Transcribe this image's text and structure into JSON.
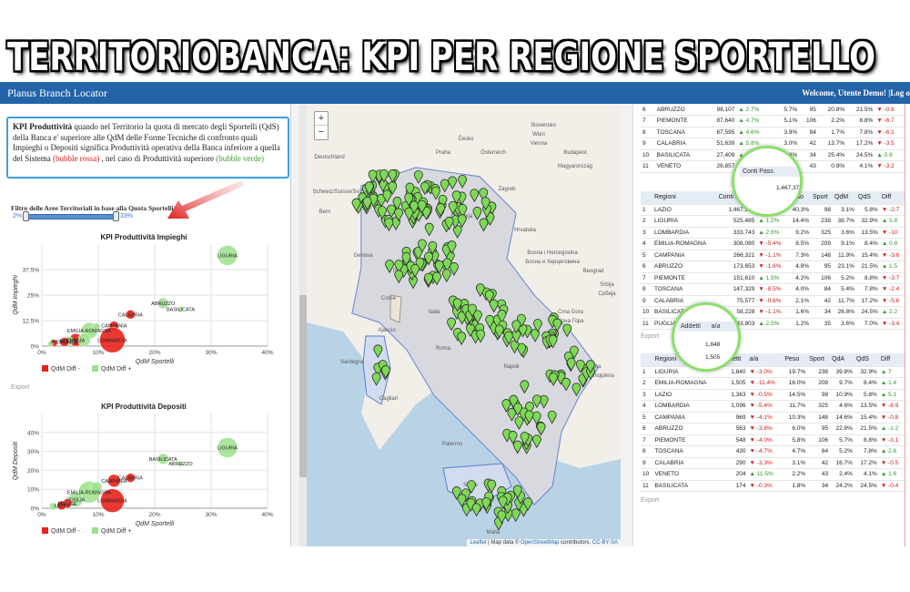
{
  "banner": {
    "title": "TERRITORIOBANCA: KPI PER REGIONE SPORTELLO"
  },
  "navbar": {
    "brand": "Planus Branch Locator",
    "user": "Welcome, Utente Demo! |Log o"
  },
  "info": {
    "bold": "KPI Produttività",
    "text1": " quando nel Territorio la quota di mercato degli Sportelli (QdS) della Banca e' superiore alle QdM delle Forme Tecniche di confronto quali Impieghi o Depositi significa Produttività operativa della Banca inferiore a quella del Sistema ",
    "red": "(bubble rossa)",
    "text2": " , nel caso di Produttività superiore ",
    "green": "(bubble verde)"
  },
  "filter": {
    "label": "Filtro delle Aree Territoriali in base alla Quota Sportelli",
    "min": "2%",
    "max": "33%",
    "low": 0.0,
    "high": 1.0
  },
  "export_label": "Export",
  "chart_data": [
    {
      "type": "scatter",
      "title": "KPI Produttività Impieghi",
      "xlabel": "QdM Sportelli",
      "ylabel": "QdM Impieghi",
      "xlim": [
        0,
        40
      ],
      "ylim": [
        0,
        50
      ],
      "xticks": [
        "0%",
        "10%",
        "20%",
        "30%",
        "40%"
      ],
      "yticks": [
        "0%",
        "12.5%",
        "25%",
        "37.5%"
      ],
      "yticks_values": [
        0,
        12.5,
        25,
        37.5
      ],
      "legend": [
        {
          "name": "QdM Diff -",
          "color": "#e8221c"
        },
        {
          "name": "QdM Diff +",
          "color": "#9be08b"
        }
      ],
      "points": [
        {
          "x": 32.9,
          "y": 44.5,
          "r": 11,
          "label": "LIGURIA",
          "pos": 1
        },
        {
          "x": 21.5,
          "y": 21,
          "r": 6,
          "label": "ABRUZZO",
          "pos": 1
        },
        {
          "x": 24.6,
          "y": 18,
          "r": 3,
          "label": "BASILICATA",
          "pos": 1
        },
        {
          "x": 15.7,
          "y": 15.5,
          "r": 5,
          "label": "CALABRIA",
          "pos": 0
        },
        {
          "x": 12.8,
          "y": 10,
          "r": 5,
          "label": "CAMPANIA",
          "pos": 0
        },
        {
          "x": 8.4,
          "y": 7.5,
          "r": 9,
          "label": "EMILIA-ROMAGNA",
          "pos": 1
        },
        {
          "x": 6,
          "y": 3,
          "r": 7,
          "label": "PUGLIA",
          "pos": 0
        },
        {
          "x": 4.8,
          "y": 2.5,
          "r": 5,
          "label": "MOLISE",
          "pos": 1
        },
        {
          "x": 2.1,
          "y": 1.5,
          "r": 4,
          "label": "",
          "pos": 0
        },
        {
          "x": 12.5,
          "y": 3,
          "r": 14,
          "label": "LOMBARDIA",
          "pos": 0
        },
        {
          "x": 4,
          "y": 2,
          "r": 5,
          "label": "PIEMONTE",
          "pos": 0
        },
        {
          "x": 1.5,
          "y": 1,
          "r": 3,
          "label": "",
          "pos": 1
        },
        {
          "x": 9.7,
          "y": 9.5,
          "r": 4,
          "label": "",
          "pos": 1
        },
        {
          "x": 7.5,
          "y": 3,
          "r": 7,
          "label": "",
          "pos": 1
        }
      ]
    },
    {
      "type": "scatter",
      "title": "KPI Produttività Depositi",
      "xlabel": "QdM Sportelli",
      "ylabel": "QdM Depositi",
      "xlim": [
        0,
        40
      ],
      "ylim": [
        0,
        50
      ],
      "xticks": [
        "0%",
        "10%",
        "20%",
        "30%",
        "40%"
      ],
      "yticks": [
        "0%",
        "10%",
        "20%",
        "30%",
        "40%"
      ],
      "yticks_values": [
        0,
        10,
        20,
        30,
        40
      ],
      "legend": [
        {
          "name": "QdM Diff -",
          "color": "#e8221c"
        },
        {
          "name": "QdM Diff +",
          "color": "#9be08b"
        }
      ],
      "points": [
        {
          "x": 32.9,
          "y": 32,
          "r": 11,
          "label": "LIGURIA",
          "pos": 1
        },
        {
          "x": 21.5,
          "y": 26,
          "r": 6,
          "label": "BASILICATA",
          "pos": 1
        },
        {
          "x": 24.6,
          "y": 23.5,
          "r": 3,
          "label": "ABRUZZO",
          "pos": 1
        },
        {
          "x": 15.7,
          "y": 16,
          "r": 5,
          "label": "CALABRIA",
          "pos": 0
        },
        {
          "x": 12.8,
          "y": 14.5,
          "r": 7,
          "label": "CAMPANIA",
          "pos": 0
        },
        {
          "x": 8.4,
          "y": 8.5,
          "r": 12,
          "label": "EMILIA-ROMAGNA",
          "pos": 1
        },
        {
          "x": 6,
          "y": 4.5,
          "r": 8,
          "label": "PUGLIA",
          "pos": 1
        },
        {
          "x": 4.5,
          "y": 2.5,
          "r": 5,
          "label": "MOLISE",
          "pos": 0
        },
        {
          "x": 3.5,
          "y": 1.5,
          "r": 5,
          "label": "LAZIO",
          "pos": 0
        },
        {
          "x": 12.5,
          "y": 4,
          "r": 13,
          "label": "LOMBARDIA",
          "pos": 0
        },
        {
          "x": 9.7,
          "y": 11,
          "r": 6,
          "label": "",
          "pos": 1
        },
        {
          "x": 2,
          "y": 1,
          "r": 4,
          "label": "",
          "pos": 1
        }
      ]
    }
  ],
  "map": {
    "zoom_in": "+",
    "zoom_out": "−",
    "attribution_leaflet": "Leaflet",
    "attribution_text": " | Map data © ",
    "attribution_osm": "OpenStreetMap",
    "attribution_tail": " contributors, ",
    "attribution_cc": "CC-BY-SA",
    "labels": [
      "Praha",
      "Česko",
      "Deutschland",
      "Österreich",
      "Slovensko",
      "Budapest",
      "Magyarország",
      "Schweiz/Suisse/Svizzera",
      "Slovenija",
      "Zagreb",
      "Hrvatska",
      "Bosna i Hercegovina",
      "Босна и Херцеговина",
      "Srbija",
      "Србија",
      "Crna Gora",
      "Црна Гора",
      "Shqipëria",
      "Tirana",
      "Italia",
      "Genova",
      "Firenze",
      "Roma",
      "Napoli",
      "Corse",
      "Sardegna",
      "Cagliari",
      "Ajaccio",
      "Sicilia",
      "Palermo",
      "Malta",
      "Bern",
      "Beograd",
      "Vienna",
      "Wien"
    ]
  },
  "tables": {
    "table1": {
      "rows": [
        [
          "6",
          "ABRUZZO",
          "98,107",
          "up",
          "2.7%",
          "5.7%",
          "95",
          "20.8%",
          "21.5%",
          "down",
          "-0.8"
        ],
        [
          "7",
          "PIEMONTE",
          "87,640",
          "up",
          "4.7%",
          "5.1%",
          "106",
          "2.2%",
          "8.8%",
          "down",
          "-6.7"
        ],
        [
          "8",
          "TOSCANA",
          "67,595",
          "up",
          "4.6%",
          "3.9%",
          "84",
          "1.7%",
          "7.8%",
          "down",
          "-6.1"
        ],
        [
          "9",
          "CALABRIA",
          "51,639",
          "up",
          "5.8%",
          "3.0%",
          "42",
          "13.7%",
          "17.2%",
          "down",
          "-3.5"
        ],
        [
          "10",
          "BASILICATA",
          "27,409",
          "up",
          "2.2%",
          "1.6%",
          "34",
          "25.4%",
          "24.5%",
          "up",
          "0.9"
        ],
        [
          "11",
          "VENETO",
          "26,857",
          "up",
          "15.8%",
          "1.6%",
          "43",
          "0.9%",
          "4.1%",
          "down",
          "-3.2"
        ]
      ]
    },
    "table2": {
      "headers": [
        "Regioni",
        "Conti Pass",
        "a/a",
        "Peso",
        "Sport",
        "QdM",
        "QdS",
        "Diff"
      ],
      "rows": [
        [
          "1",
          "LAZIO",
          "1,467,375",
          "up",
          "6.9%",
          "40.3%",
          "98",
          "3.1%",
          "5.8%",
          "down",
          "-2.7"
        ],
        [
          "2",
          "LIGURIA",
          "525,485",
          "up",
          "1.2%",
          "14.4%",
          "238",
          "38.7%",
          "32.9%",
          "up",
          "5.8"
        ],
        [
          "3",
          "LOMBARDIA",
          "333,743",
          "up",
          "2.6%",
          "9.2%",
          "325",
          "3.6%",
          "13.5%",
          "down",
          "-10"
        ],
        [
          "4",
          "EMILIA-ROMAGNA",
          "308,080",
          "down",
          "-5.4%",
          "8.5%",
          "209",
          "9.1%",
          "8.4%",
          "up",
          "0.8"
        ],
        [
          "5",
          "CAMPANIA",
          "266,321",
          "down",
          "-1.1%",
          "7.3%",
          "148",
          "11.9%",
          "15.4%",
          "down",
          "-3.6"
        ],
        [
          "6",
          "ABRUZZO",
          "173,653",
          "down",
          "-1.6%",
          "4.8%",
          "95",
          "23.1%",
          "21.5%",
          "up",
          "1.5"
        ],
        [
          "7",
          "PIEMONTE",
          "151,610",
          "up",
          "1.5%",
          "4.2%",
          "106",
          "5.2%",
          "8.8%",
          "down",
          "-3.7"
        ],
        [
          "8",
          "TOSCANA",
          "147,329",
          "down",
          "-8.5%",
          "4.0%",
          "84",
          "5.4%",
          "7.8%",
          "down",
          "-2.4"
        ],
        [
          "9",
          "CALABRIA",
          "75,577",
          "down",
          "-0.6%",
          "2.1%",
          "42",
          "11.7%",
          "17.2%",
          "down",
          "-5.6"
        ],
        [
          "10",
          "BASILICATA",
          "58,228",
          "down",
          "-1.1%",
          "1.6%",
          "34",
          "26.8%",
          "24.5%",
          "up",
          "2.2"
        ],
        [
          "11",
          "PUGLIA",
          "43,803",
          "up",
          "2.5%",
          "1.2%",
          "35",
          "3.6%",
          "7.0%",
          "down",
          "-3.4"
        ]
      ]
    },
    "table3": {
      "headers": [
        "Regioni",
        "Addetti",
        "a/a",
        "Peso",
        "Sport",
        "QdA",
        "QdS",
        "Diff"
      ],
      "rows": [
        [
          "1",
          "LIGURIA",
          "1,840",
          "down",
          "-3.0%",
          "19.7%",
          "238",
          "39.8%",
          "32.9%",
          "up",
          "7"
        ],
        [
          "2",
          "EMILIA-ROMAGNA",
          "1,505",
          "down",
          "-11.4%",
          "16.0%",
          "209",
          "9.7%",
          "8.4%",
          "up",
          "1.4"
        ],
        [
          "3",
          "LAZIO",
          "1,363",
          "down",
          "-0.5%",
          "14.5%",
          "98",
          "10.9%",
          "5.8%",
          "up",
          "5.1"
        ],
        [
          "4",
          "LOMBARDIA",
          "1,096",
          "down",
          "-5.4%",
          "11.7%",
          "325",
          "4.6%",
          "13.5%",
          "down",
          "-8.9"
        ],
        [
          "5",
          "CAMPANIA",
          "969",
          "down",
          "-4.1%",
          "10.3%",
          "148",
          "14.6%",
          "15.4%",
          "down",
          "-0.8"
        ],
        [
          "6",
          "ABRUZZO",
          "563",
          "down",
          "-3.8%",
          "6.0%",
          "95",
          "22.8%",
          "21.5%",
          "up",
          "-1.2"
        ],
        [
          "7",
          "PIEMONTE",
          "548",
          "down",
          "-4.0%",
          "5.8%",
          "106",
          "5.7%",
          "8.8%",
          "down",
          "-3.1"
        ],
        [
          "8",
          "TOSCANA",
          "430",
          "down",
          "-4.7%",
          "4.7%",
          "84",
          "5.2%",
          "7.8%",
          "up",
          "2.6"
        ],
        [
          "9",
          "CALABRIA",
          "290",
          "down",
          "-3.3%",
          "3.1%",
          "42",
          "16.7%",
          "17.2%",
          "down",
          "-0.5"
        ],
        [
          "10",
          "VENETO",
          "204",
          "up",
          "11.5%",
          "2.2%",
          "43",
          "2.4%",
          "4.1%",
          "up",
          "1.6"
        ],
        [
          "11",
          "BASILICATA",
          "174",
          "down",
          "-0.3%",
          "1.8%",
          "34",
          "24.2%",
          "24.5%",
          "down",
          "-0.4"
        ]
      ]
    },
    "callout1": {
      "header": "Conti Pass",
      "value": "1,467,37"
    },
    "callout2": {
      "header": "Addetti",
      "header2": "a/a",
      "value1": "1,848",
      "value2": "1,505"
    }
  },
  "colors": {
    "accent": "#2463a8",
    "neg": "#e8221c",
    "pos": "#9be08b",
    "marker": "#7ed957"
  }
}
